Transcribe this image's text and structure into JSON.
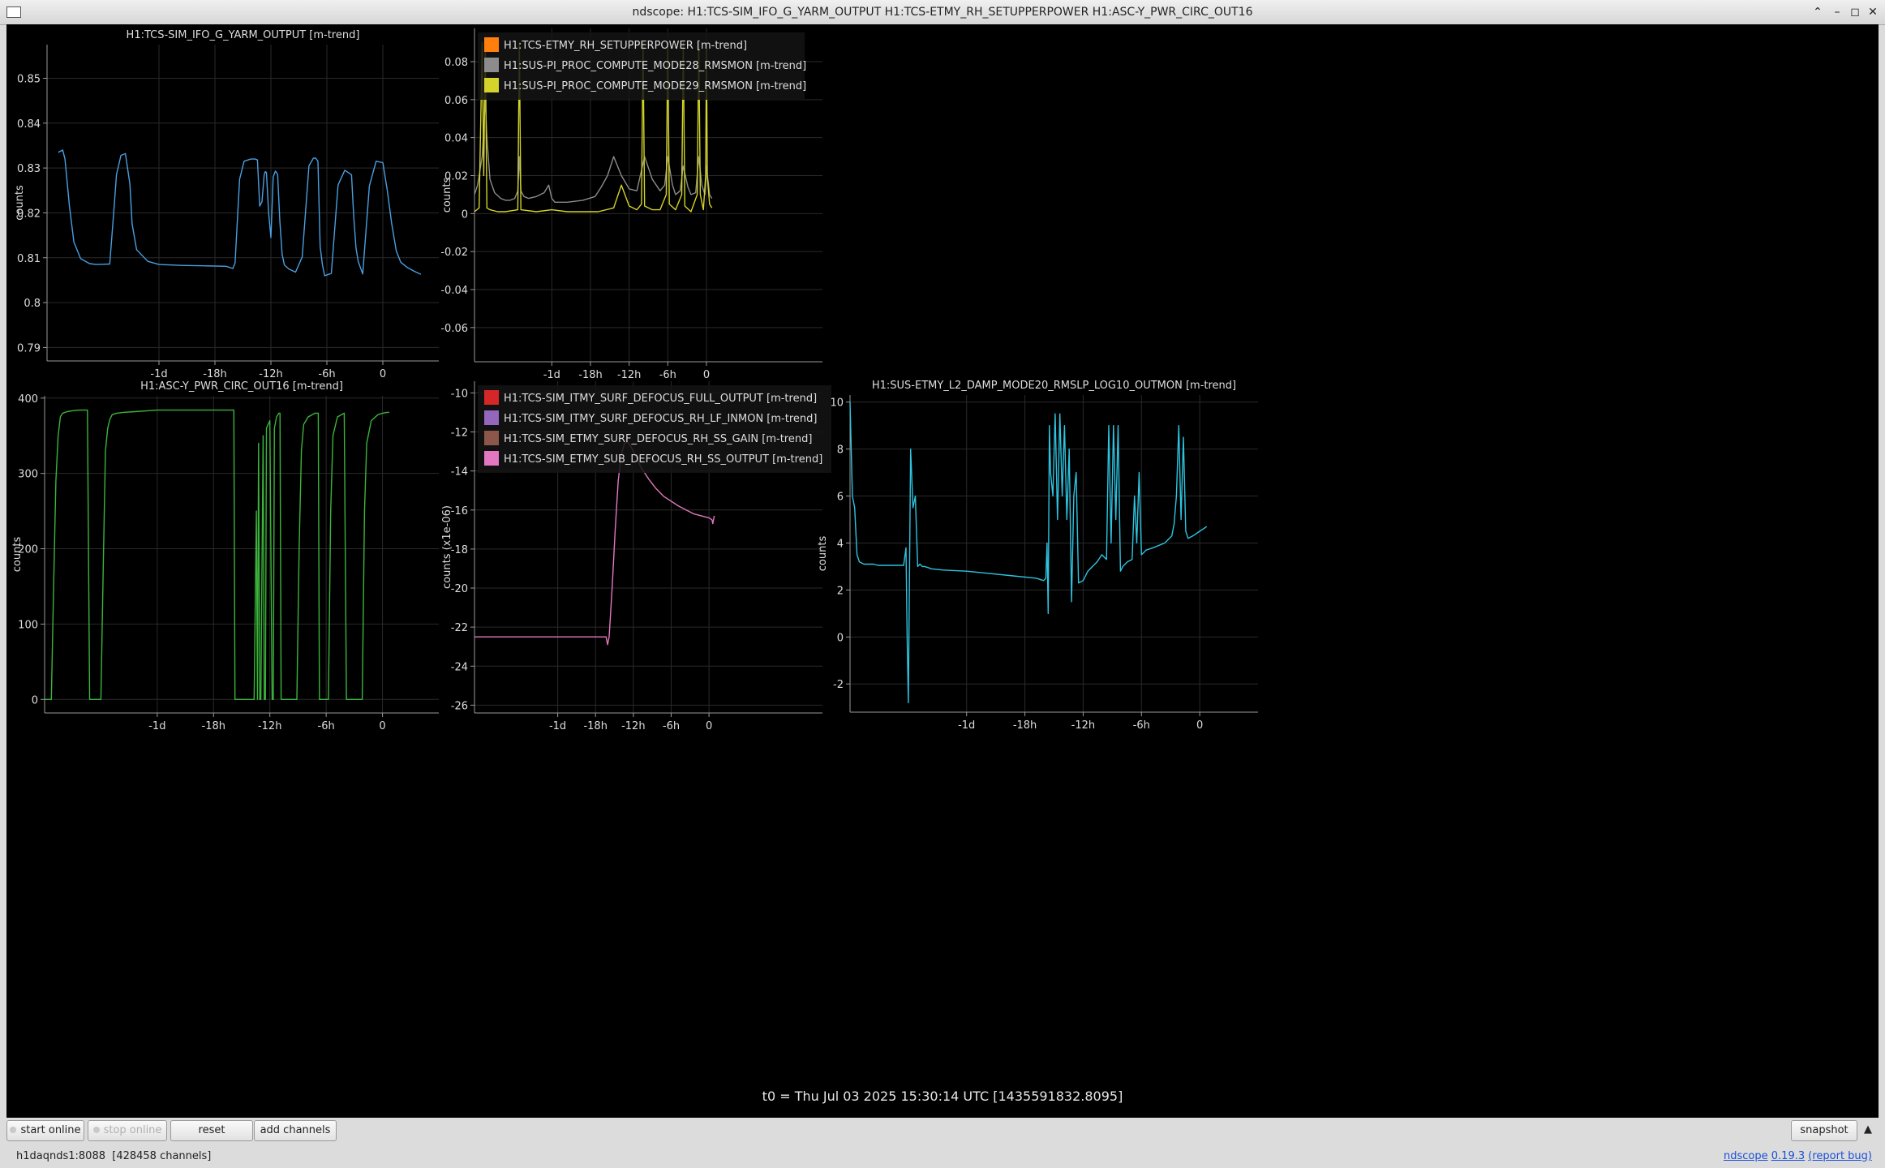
{
  "window": {
    "title": "ndscope: H1:TCS-SIM_IFO_G_YARM_OUTPUT H1:TCS-ETMY_RH_SETUPPERPOWER H1:ASC-Y_PWR_CIRC_OUT16"
  },
  "t0_label": "t0 = Thu Jul 03 2025 15:30:14 UTC [1435591832.8095]",
  "toolbar": {
    "start_online": "start online",
    "stop_online": "stop online",
    "reset": "reset",
    "add_channels": "add channels",
    "snapshot": "snapshot"
  },
  "status": {
    "server": "h1daqnds1:8088",
    "channels": "[428458 channels]",
    "app_name": "ndscope",
    "version": "0.19.3",
    "report_bug": "(report bug)"
  },
  "colors": {
    "background": "#000000",
    "grid": "#2a2a2a",
    "axis": "#9a9a9a",
    "blue": "#4a9fe0",
    "orange": "#ff7f0e",
    "gray": "#8c8c8c",
    "yellow": "#d4d42a",
    "green": "#3cb43c",
    "red": "#d62728",
    "purple": "#9467bd",
    "brown": "#8c564b",
    "pink": "#e377c2",
    "cyan": "#2ec4e0"
  },
  "chart_data": [
    {
      "type": "line",
      "title": "H1:TCS-SIM_IFO_G_YARM_OUTPUT [m-trend]",
      "ylabel": "counts",
      "xlim": [
        -1.5,
        0.25
      ],
      "ylim": [
        0.787,
        0.8575
      ],
      "x_ticks": [
        -1,
        -0.75,
        -0.5,
        -0.25,
        0
      ],
      "x_tick_labels": [
        "-1d",
        "-18h",
        "-12h",
        "-6h",
        "0"
      ],
      "y_ticks": [
        0.79,
        0.8,
        0.81,
        0.82,
        0.83,
        0.84,
        0.85
      ],
      "y_tick_labels": [
        "0.79",
        "0.8",
        "0.81",
        "0.82",
        "0.83",
        "0.84",
        "0.85"
      ],
      "legend": [],
      "series": [
        {
          "color": "blue",
          "x": [
            -1.45,
            -1.43,
            -1.42,
            -1.4,
            -1.38,
            -1.35,
            -1.31,
            -1.28,
            -1.22,
            -1.2,
            -1.19,
            -1.17,
            -1.15,
            -1.13,
            -1.12,
            -1.1,
            -1.05,
            -1.0,
            -0.9,
            -0.8,
            -0.7,
            -0.67,
            -0.66,
            -0.64,
            -0.62,
            -0.59,
            -0.57,
            -0.56,
            -0.55,
            -0.54,
            -0.53,
            -0.525,
            -0.52,
            -0.51,
            -0.5,
            -0.49,
            -0.48,
            -0.475,
            -0.47,
            -0.46,
            -0.45,
            -0.44,
            -0.42,
            -0.39,
            -0.36,
            -0.33,
            -0.31,
            -0.3,
            -0.29,
            -0.28,
            -0.27,
            -0.26,
            -0.23,
            -0.2,
            -0.17,
            -0.14,
            -0.13,
            -0.12,
            -0.11,
            -0.09,
            -0.06,
            -0.03,
            0.0,
            0.02,
            0.04,
            0.06,
            0.08,
            0.11,
            0.14,
            0.17
          ],
          "values": [
            0.8335,
            0.834,
            0.832,
            0.8215,
            0.8135,
            0.8098,
            0.8087,
            0.8085,
            0.8086,
            0.8215,
            0.8285,
            0.8328,
            0.8332,
            0.8265,
            0.8175,
            0.8118,
            0.8092,
            0.8085,
            0.8083,
            0.8082,
            0.8081,
            0.8076,
            0.8088,
            0.8275,
            0.8315,
            0.832,
            0.832,
            0.8318,
            0.8215,
            0.8225,
            0.8285,
            0.8292,
            0.829,
            0.82,
            0.8145,
            0.828,
            0.8293,
            0.829,
            0.8285,
            0.8182,
            0.8108,
            0.8084,
            0.8075,
            0.8068,
            0.8102,
            0.8305,
            0.8322,
            0.8322,
            0.8315,
            0.8125,
            0.8085,
            0.806,
            0.8065,
            0.8262,
            0.8295,
            0.8285,
            0.8192,
            0.8122,
            0.8092,
            0.8064,
            0.826,
            0.8315,
            0.8312,
            0.825,
            0.8175,
            0.8115,
            0.809,
            0.8078,
            0.807,
            0.8063
          ]
        }
      ]
    },
    {
      "type": "line",
      "title": "",
      "ylabel": "counts",
      "xlim": [
        -1.5,
        0.75
      ],
      "ylim": [
        -0.078,
        0.0975
      ],
      "x_ticks": [
        -1,
        -0.75,
        -0.5,
        -0.25,
        0
      ],
      "x_tick_labels": [
        "-1d",
        "-18h",
        "-12h",
        "-6h",
        "0"
      ],
      "y_ticks": [
        -0.06,
        -0.04,
        -0.02,
        0,
        0.02,
        0.04,
        0.06,
        0.08
      ],
      "y_tick_labels": [
        "-0.06",
        "-0.04",
        "-0.02",
        "0",
        "0.02",
        "0.04",
        "0.06",
        "0.08"
      ],
      "legend": [
        {
          "label": "H1:TCS-ETMY_RH_SETUPPERPOWER [m-trend]",
          "color": "orange"
        },
        {
          "label": "H1:SUS-PI_PROC_COMPUTE_MODE28_RMSMON [m-trend]",
          "color": "gray"
        },
        {
          "label": "H1:SUS-PI_PROC_COMPUTE_MODE29_RMSMON [m-trend]",
          "color": "yellow"
        }
      ],
      "series": [
        {
          "color": "gray",
          "x": [
            -1.5,
            -1.48,
            -1.45,
            -1.43,
            -1.42,
            -1.4,
            -1.37,
            -1.33,
            -1.3,
            -1.27,
            -1.24,
            -1.22,
            -1.21,
            -1.2,
            -1.18,
            -1.15,
            -1.1,
            -1.05,
            -1.02,
            -1.0,
            -0.98,
            -0.9,
            -0.8,
            -0.72,
            -0.68,
            -0.64,
            -0.6,
            -0.55,
            -0.5,
            -0.45,
            -0.4,
            -0.35,
            -0.3,
            -0.27,
            -0.25,
            -0.22,
            -0.2,
            -0.17,
            -0.15,
            -0.12,
            -0.1,
            -0.07,
            -0.05,
            -0.03,
            -0.01,
            0.0,
            0.02,
            0.035
          ],
          "values": [
            0.01,
            0.015,
            0.03,
            0.06,
            0.04,
            0.018,
            0.011,
            0.008,
            0.007,
            0.007,
            0.008,
            0.012,
            0.03,
            0.012,
            0.009,
            0.008,
            0.009,
            0.011,
            0.015,
            0.008,
            0.006,
            0.006,
            0.007,
            0.009,
            0.014,
            0.02,
            0.03,
            0.02,
            0.013,
            0.012,
            0.03,
            0.018,
            0.012,
            0.015,
            0.03,
            0.015,
            0.01,
            0.012,
            0.025,
            0.014,
            0.01,
            0.011,
            0.03,
            0.015,
            0.01,
            0.025,
            0.01,
            0.008
          ]
        },
        {
          "color": "yellow",
          "x": [
            -1.5,
            -1.47,
            -1.45,
            -1.44,
            -1.43,
            -1.42,
            -1.4,
            -1.35,
            -1.3,
            -1.22,
            -1.21,
            -1.2,
            -1.1,
            -1.0,
            -0.9,
            -0.8,
            -0.7,
            -0.6,
            -0.55,
            -0.5,
            -0.45,
            -0.42,
            -0.41,
            -0.4,
            -0.35,
            -0.3,
            -0.26,
            -0.25,
            -0.24,
            -0.2,
            -0.16,
            -0.15,
            -0.14,
            -0.1,
            -0.06,
            -0.05,
            -0.04,
            -0.02,
            -0.005,
            0.0,
            0.005,
            0.02,
            0.035
          ],
          "values": [
            0.001,
            0.003,
            0.09,
            0.02,
            0.09,
            0.003,
            0.002,
            0.001,
            0.001,
            0.002,
            0.09,
            0.002,
            0.001,
            0.002,
            0.001,
            0.001,
            0.001,
            0.003,
            0.015,
            0.004,
            0.002,
            0.005,
            0.09,
            0.004,
            0.002,
            0.002,
            0.01,
            0.09,
            0.005,
            0.002,
            0.01,
            0.09,
            0.004,
            0.001,
            0.01,
            0.09,
            0.01,
            0.002,
            0.02,
            0.09,
            0.02,
            0.005,
            0.003
          ]
        }
      ]
    },
    {
      "type": "line",
      "title": "H1:ASC-Y_PWR_CIRC_OUT16 [m-trend]",
      "ylabel": "counts",
      "xlim": [
        -1.5,
        0.25
      ],
      "ylim": [
        -18,
        403
      ],
      "x_ticks": [
        -1,
        -0.75,
        -0.5,
        -0.25,
        0
      ],
      "x_tick_labels": [
        "-1d",
        "-18h",
        "-12h",
        "-6h",
        "0"
      ],
      "y_ticks": [
        0,
        100,
        200,
        300,
        400
      ],
      "y_tick_labels": [
        "0",
        "100",
        "200",
        "300",
        "400"
      ],
      "legend": [],
      "series": [
        {
          "color": "green",
          "x": [
            -1.5,
            -1.47,
            -1.46,
            -1.45,
            -1.44,
            -1.43,
            -1.42,
            -1.4,
            -1.38,
            -1.35,
            -1.32,
            -1.31,
            -1.3,
            -1.26,
            -1.25,
            -1.24,
            -1.23,
            -1.22,
            -1.21,
            -1.2,
            -1.18,
            -1.15,
            -1.1,
            -1.05,
            -1.0,
            -0.9,
            -0.8,
            -0.7,
            -0.66,
            -0.655,
            -0.58,
            -0.57,
            -0.56,
            -0.555,
            -0.55,
            -0.545,
            -0.54,
            -0.53,
            -0.525,
            -0.52,
            -0.515,
            -0.5,
            -0.49,
            -0.485,
            -0.48,
            -0.47,
            -0.46,
            -0.455,
            -0.45,
            -0.44,
            -0.38,
            -0.37,
            -0.36,
            -0.35,
            -0.33,
            -0.3,
            -0.285,
            -0.28,
            -0.25,
            -0.24,
            -0.23,
            -0.22,
            -0.2,
            -0.17,
            -0.16,
            -0.1,
            -0.09,
            -0.08,
            -0.07,
            -0.05,
            -0.02,
            0.0,
            0.02,
            0.03
          ],
          "values": [
            0,
            0,
            150,
            290,
            350,
            375,
            380,
            382,
            383,
            384,
            384,
            384,
            0,
            0,
            0,
            170,
            330,
            360,
            372,
            378,
            380,
            381,
            382,
            383,
            384,
            384,
            384,
            384,
            384,
            0,
            0,
            0,
            250,
            0,
            340,
            0,
            0,
            350,
            0,
            0,
            360,
            370,
            0,
            0,
            360,
            375,
            380,
            380,
            0,
            0,
            0,
            200,
            330,
            365,
            375,
            380,
            380,
            0,
            0,
            0,
            250,
            350,
            375,
            380,
            0,
            0,
            0,
            250,
            340,
            370,
            378,
            380,
            381,
            381
          ]
        }
      ]
    },
    {
      "type": "line",
      "title": "",
      "ylabel": "counts (x1e-06)",
      "xlim": [
        -1.55,
        0.75
      ],
      "ylim": [
        -26.4,
        -9.4
      ],
      "x_ticks": [
        -1,
        -0.75,
        -0.5,
        -0.25,
        0
      ],
      "x_tick_labels": [
        "-1d",
        "-18h",
        "-12h",
        "-6h",
        "0"
      ],
      "y_ticks": [
        -26,
        -24,
        -22,
        -20,
        -18,
        -16,
        -14,
        -12,
        -10
      ],
      "y_tick_labels": [
        "-26",
        "-24",
        "-22",
        "-20",
        "-18",
        "-16",
        "-14",
        "-12",
        "-10"
      ],
      "legend": [
        {
          "label": "H1:TCS-SIM_ITMY_SURF_DEFOCUS_FULL_OUTPUT [m-trend]",
          "color": "red"
        },
        {
          "label": "H1:TCS-SIM_ITMY_SURF_DEFOCUS_RH_LF_INMON [m-trend]",
          "color": "purple"
        },
        {
          "label": "H1:TCS-SIM_ETMY_SURF_DEFOCUS_RH_SS_GAIN [m-trend]",
          "color": "brown"
        },
        {
          "label": "H1:TCS-SIM_ETMY_SUB_DEFOCUS_RH_SS_OUTPUT [m-trend]",
          "color": "pink"
        }
      ],
      "series": [
        {
          "color": "pink",
          "x": [
            -1.55,
            -1.2,
            -0.9,
            -0.68,
            -0.67,
            -0.66,
            -0.64,
            -0.62,
            -0.6,
            -0.58,
            -0.56,
            -0.54,
            -0.52,
            -0.5,
            -0.45,
            -0.4,
            -0.35,
            -0.3,
            -0.2,
            -0.1,
            0.0,
            0.02,
            0.025,
            0.03,
            0.035
          ],
          "values": [
            -22.5,
            -22.5,
            -22.5,
            -22.5,
            -22.9,
            -22.5,
            -20.0,
            -17.0,
            -14.5,
            -13.2,
            -12.6,
            -12.5,
            -12.7,
            -13.0,
            -13.8,
            -14.4,
            -14.9,
            -15.3,
            -15.8,
            -16.2,
            -16.4,
            -16.5,
            -16.7,
            -16.5,
            -16.3
          ]
        }
      ]
    },
    {
      "type": "line",
      "title": "H1:SUS-ETMY_L2_DAMP_MODE20_RMSLP_LOG10_OUTMON [m-trend]",
      "ylabel": "counts",
      "xlim": [
        -1.5,
        0.25
      ],
      "ylim": [
        -3.2,
        10.3
      ],
      "x_ticks": [
        -1,
        -0.75,
        -0.5,
        -0.25,
        0
      ],
      "x_tick_labels": [
        "-1d",
        "-18h",
        "-12h",
        "-6h",
        "0"
      ],
      "y_ticks": [
        -2,
        0,
        2,
        4,
        6,
        8,
        10
      ],
      "y_tick_labels": [
        "-2",
        "0",
        "2",
        "4",
        "6",
        "8",
        "10"
      ],
      "legend": [],
      "series": [
        {
          "color": "cyan",
          "x": [
            -1.5,
            -1.49,
            -1.48,
            -1.47,
            -1.46,
            -1.45,
            -1.44,
            -1.42,
            -1.4,
            -1.38,
            -1.35,
            -1.3,
            -1.27,
            -1.26,
            -1.255,
            -1.25,
            -1.24,
            -1.23,
            -1.22,
            -1.21,
            -1.2,
            -1.19,
            -1.18,
            -1.15,
            -1.1,
            -1.0,
            -0.9,
            -0.8,
            -0.7,
            -0.67,
            -0.66,
            -0.655,
            -0.65,
            -0.645,
            -0.64,
            -0.63,
            -0.62,
            -0.61,
            -0.6,
            -0.59,
            -0.58,
            -0.57,
            -0.56,
            -0.55,
            -0.54,
            -0.53,
            -0.52,
            -0.5,
            -0.48,
            -0.46,
            -0.44,
            -0.42,
            -0.4,
            -0.39,
            -0.38,
            -0.37,
            -0.36,
            -0.35,
            -0.34,
            -0.33,
            -0.31,
            -0.29,
            -0.28,
            -0.27,
            -0.26,
            -0.25,
            -0.24,
            -0.23,
            -0.2,
            -0.15,
            -0.12,
            -0.11,
            -0.1,
            -0.09,
            -0.08,
            -0.07,
            -0.06,
            -0.05,
            -0.03,
            0.0,
            0.03
          ],
          "values": [
            10,
            6.0,
            5.5,
            3.5,
            3.2,
            3.15,
            3.1,
            3.1,
            3.1,
            3.05,
            3.05,
            3.05,
            3.05,
            3.8,
            0,
            -2.8,
            8.0,
            5.5,
            6.0,
            3.0,
            3.1,
            3.0,
            3.0,
            2.9,
            2.85,
            2.8,
            2.7,
            2.6,
            2.5,
            2.4,
            2.5,
            4.0,
            1.0,
            9.0,
            7.0,
            6.0,
            9.5,
            5.0,
            9.5,
            6.0,
            9.0,
            5.0,
            8.0,
            1.5,
            6.0,
            7.0,
            2.3,
            2.4,
            2.8,
            3.0,
            3.2,
            3.5,
            3.3,
            9.0,
            4.0,
            9.0,
            5.0,
            9.0,
            2.8,
            3.0,
            3.2,
            3.3,
            6.0,
            4.0,
            7.0,
            3.5,
            3.6,
            3.7,
            3.8,
            4.0,
            4.3,
            4.8,
            6.0,
            9.0,
            5.0,
            8.5,
            4.5,
            4.2,
            4.3,
            4.5,
            4.7
          ]
        }
      ]
    }
  ]
}
